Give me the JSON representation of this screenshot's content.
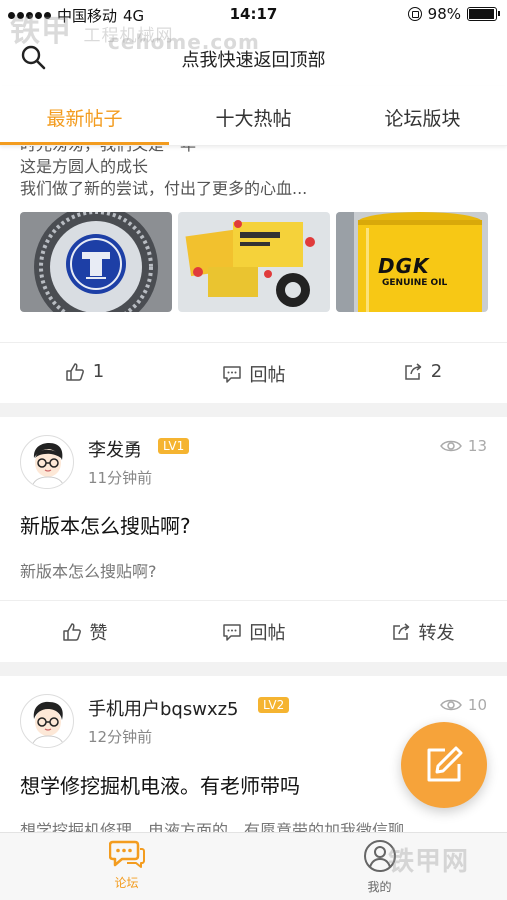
{
  "status_bar": {
    "carrier": "中国移动",
    "network": "4G",
    "time": "14:17",
    "battery": "98%",
    "battery_level": 0.98,
    "watermark_main": "铁甲",
    "watermark_sub": "工程机械网",
    "watermark_url": "cehome.com"
  },
  "header": {
    "title": "点我快速返回顶部",
    "search_icon": "search-icon"
  },
  "tabs": [
    {
      "label": "最新帖子",
      "active": true
    },
    {
      "label": "十大热帖",
      "active": false
    },
    {
      "label": "论坛版块",
      "active": false
    }
  ],
  "colors": {
    "accent": "#f39c1f",
    "fab": "#f6a33a",
    "level_badge": "#f5b431"
  },
  "posts": [
    {
      "excerpt_lines": [
        "时光匆匆，我们又是一年",
        "这是方圆人的成长",
        "我们做了新的尝试，付出了更多的心血..."
      ],
      "images": [
        {
          "icon": "bearing-logo-image",
          "text": ""
        },
        {
          "icon": "seal-kit-image",
          "text": ""
        },
        {
          "icon": "oil-bucket-image",
          "text": "DGK",
          "subtext": "GENUINE OIL"
        }
      ],
      "actions": {
        "like": "1",
        "reply": "回帖",
        "share": "2"
      }
    },
    {
      "username": "李发勇",
      "level": "LV1",
      "time": "11分钟前",
      "views": "13",
      "title": "新版本怎么搜贴啊?",
      "body": "新版本怎么搜贴啊?",
      "actions": {
        "like": "赞",
        "reply": "回帖",
        "share": "转发"
      }
    },
    {
      "username": "手机用户bqswxz5",
      "level": "LV2",
      "time": "12分钟前",
      "views": "10",
      "title": "想学修挖掘机电液。有老师带吗",
      "body": "想学挖掘机修理，电液方面的。有愿意带的加我微信聊"
    }
  ],
  "bottom_nav": [
    {
      "label": "论坛",
      "icon": "chat-bubble-icon",
      "active": true
    },
    {
      "label": "我的",
      "icon": "user-icon",
      "active": false
    }
  ],
  "bottom_watermark": "铁甲网"
}
